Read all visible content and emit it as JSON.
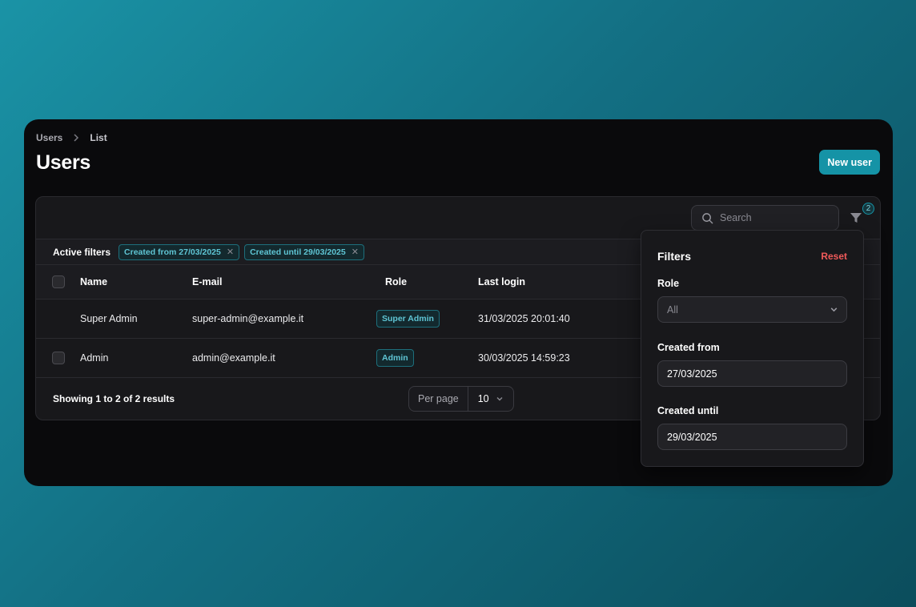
{
  "breadcrumb": {
    "root": "Users",
    "current": "List"
  },
  "page": {
    "title": "Users",
    "new_button": "New user"
  },
  "search": {
    "placeholder": "Search"
  },
  "filter_count": "2",
  "active_filters": {
    "label": "Active filters",
    "chips": [
      "Created from 27/03/2025",
      "Created until 29/03/2025"
    ]
  },
  "table": {
    "columns": {
      "name": "Name",
      "email": "E-mail",
      "role": "Role",
      "last_login": "Last login"
    },
    "rows": [
      {
        "name": "Super Admin",
        "email": "super-admin@example.it",
        "role": "Super Admin",
        "last_login": "31/03/2025 20:01:40"
      },
      {
        "name": "Admin",
        "email": "admin@example.it",
        "role": "Admin",
        "last_login": "30/03/2025 14:59:23"
      }
    ]
  },
  "pagination": {
    "showing": "Showing 1 to 2 of 2 results",
    "per_page_label": "Per page",
    "per_page_value": "10"
  },
  "filters_panel": {
    "title": "Filters",
    "reset": "Reset",
    "role_label": "Role",
    "role_value": "All",
    "created_from_label": "Created from",
    "created_from_value": "27/03/2025",
    "created_until_label": "Created until",
    "created_until_value": "29/03/2025"
  },
  "colors": {
    "accent": "#1593a6",
    "danger": "#f05a5a"
  }
}
